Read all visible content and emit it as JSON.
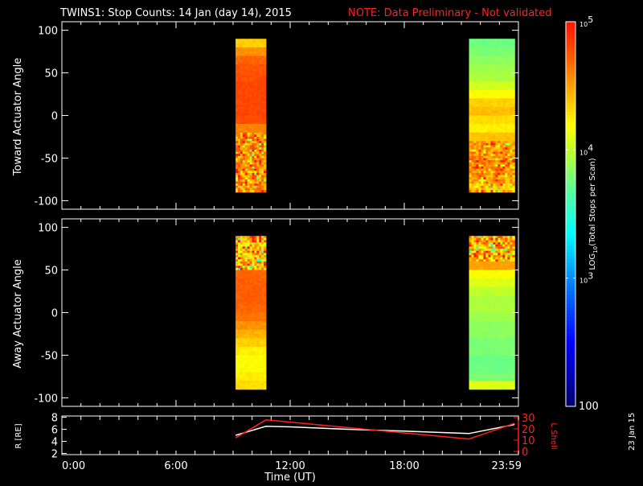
{
  "title": "TWINS1: Stop Counts: 14 Jan (day  14), 2015",
  "note": "NOTE: Data Preliminary - Not validated",
  "date_stamp": "23 Jan 15",
  "colors": {
    "note": "#ff2020",
    "l_shell": "#ff2020",
    "r_line": "#ffffff"
  },
  "chart_data": [
    {
      "type": "heatmap",
      "name": "toward",
      "ylabel": "Toward Actuator Angle",
      "ylim": [
        -110,
        110
      ],
      "yticks": [
        100,
        50,
        0,
        -50,
        -100
      ],
      "xlim": [
        0,
        24
      ],
      "angle_bins": [
        85,
        75,
        65,
        55,
        45,
        35,
        25,
        15,
        5,
        -5,
        -15,
        -25,
        -35,
        -45,
        -55,
        -65,
        -75,
        -85
      ],
      "blocks": [
        {
          "t_start": 9.13,
          "t_end": 10.73,
          "noise": 0.25,
          "noise_from": -20,
          "log_counts": [
            4.35,
            4.55,
            4.7,
            4.75,
            4.78,
            4.8,
            4.8,
            4.8,
            4.8,
            4.78,
            4.6,
            4.55,
            4.6,
            4.5,
            4.55,
            4.5,
            4.55,
            4.5
          ]
        },
        {
          "t_start": 21.4,
          "t_end": 23.8,
          "noise": 0.2,
          "noise_from": -30,
          "log_counts": [
            3.75,
            3.8,
            3.85,
            3.9,
            3.95,
            4.05,
            4.2,
            4.35,
            4.4,
            4.3,
            4.25,
            4.4,
            4.5,
            4.55,
            4.6,
            4.55,
            4.5,
            4.4
          ]
        }
      ]
    },
    {
      "type": "heatmap",
      "name": "away",
      "ylabel": "Away Actuator Angle",
      "ylim": [
        -110,
        110
      ],
      "yticks": [
        100,
        50,
        0,
        -50,
        -100
      ],
      "xlim": [
        0,
        24
      ],
      "angle_bins": [
        85,
        75,
        65,
        55,
        45,
        35,
        25,
        15,
        5,
        -5,
        -15,
        -25,
        -35,
        -45,
        -55,
        -65,
        -75,
        -85
      ],
      "blocks": [
        {
          "t_start": 9.13,
          "t_end": 10.73,
          "noise": 0.35,
          "noise_to": 50,
          "log_counts": [
            4.45,
            4.4,
            4.35,
            4.4,
            4.7,
            4.72,
            4.72,
            4.72,
            4.7,
            4.65,
            4.55,
            4.45,
            4.35,
            4.25,
            4.2,
            4.2,
            4.25,
            4.3
          ]
        },
        {
          "t_start": 21.4,
          "t_end": 23.8,
          "noise": 0.35,
          "noise_to": 55,
          "log_counts": [
            4.5,
            4.45,
            4.4,
            4.5,
            4.2,
            4.1,
            4.0,
            3.95,
            3.95,
            3.9,
            3.85,
            3.85,
            3.8,
            3.8,
            3.75,
            3.75,
            3.8,
            4.1
          ]
        }
      ]
    },
    {
      "type": "line",
      "name": "orbit",
      "ylabel": "R [RE]",
      "ylabel2": "L Shell",
      "ylim": [
        1.8,
        8.2
      ],
      "yticks": [
        8,
        6,
        4,
        2
      ],
      "ylim2": [
        0,
        30
      ],
      "yticks2": [
        30,
        20,
        10,
        0
      ],
      "xlabel": "Time (UT)",
      "xticks": [
        0,
        6,
        12,
        18,
        23.983
      ],
      "xtick_labels": [
        "0:00",
        "6:00",
        "12:00",
        "18:00",
        "23:59"
      ],
      "series": [
        {
          "name": "R",
          "axis": "left",
          "x": [
            9.13,
            10.73,
            12,
            15,
            18,
            21.4,
            23.8
          ],
          "y": [
            5.0,
            6.5,
            6.4,
            6.0,
            5.7,
            5.3,
            6.8
          ]
        },
        {
          "name": "L Shell",
          "axis": "right",
          "x": [
            9.13,
            10.73,
            21.4,
            23.8
          ],
          "y": [
            12,
            28,
            11,
            25
          ]
        }
      ]
    }
  ],
  "colorbar": {
    "label": "LOG10(Total Stops per Scan)",
    "label_main": "LOG",
    "label_sub": "10",
    "label_rest": "(Total Stops per Scan)",
    "range_log": [
      2,
      5
    ],
    "ticks": [
      {
        "base": "10",
        "exp": "5",
        "v": 5
      },
      {
        "base": "10",
        "exp": "4",
        "v": 4
      },
      {
        "base": "10",
        "exp": "3",
        "v": 3
      }
    ],
    "bottom_label": "100"
  }
}
